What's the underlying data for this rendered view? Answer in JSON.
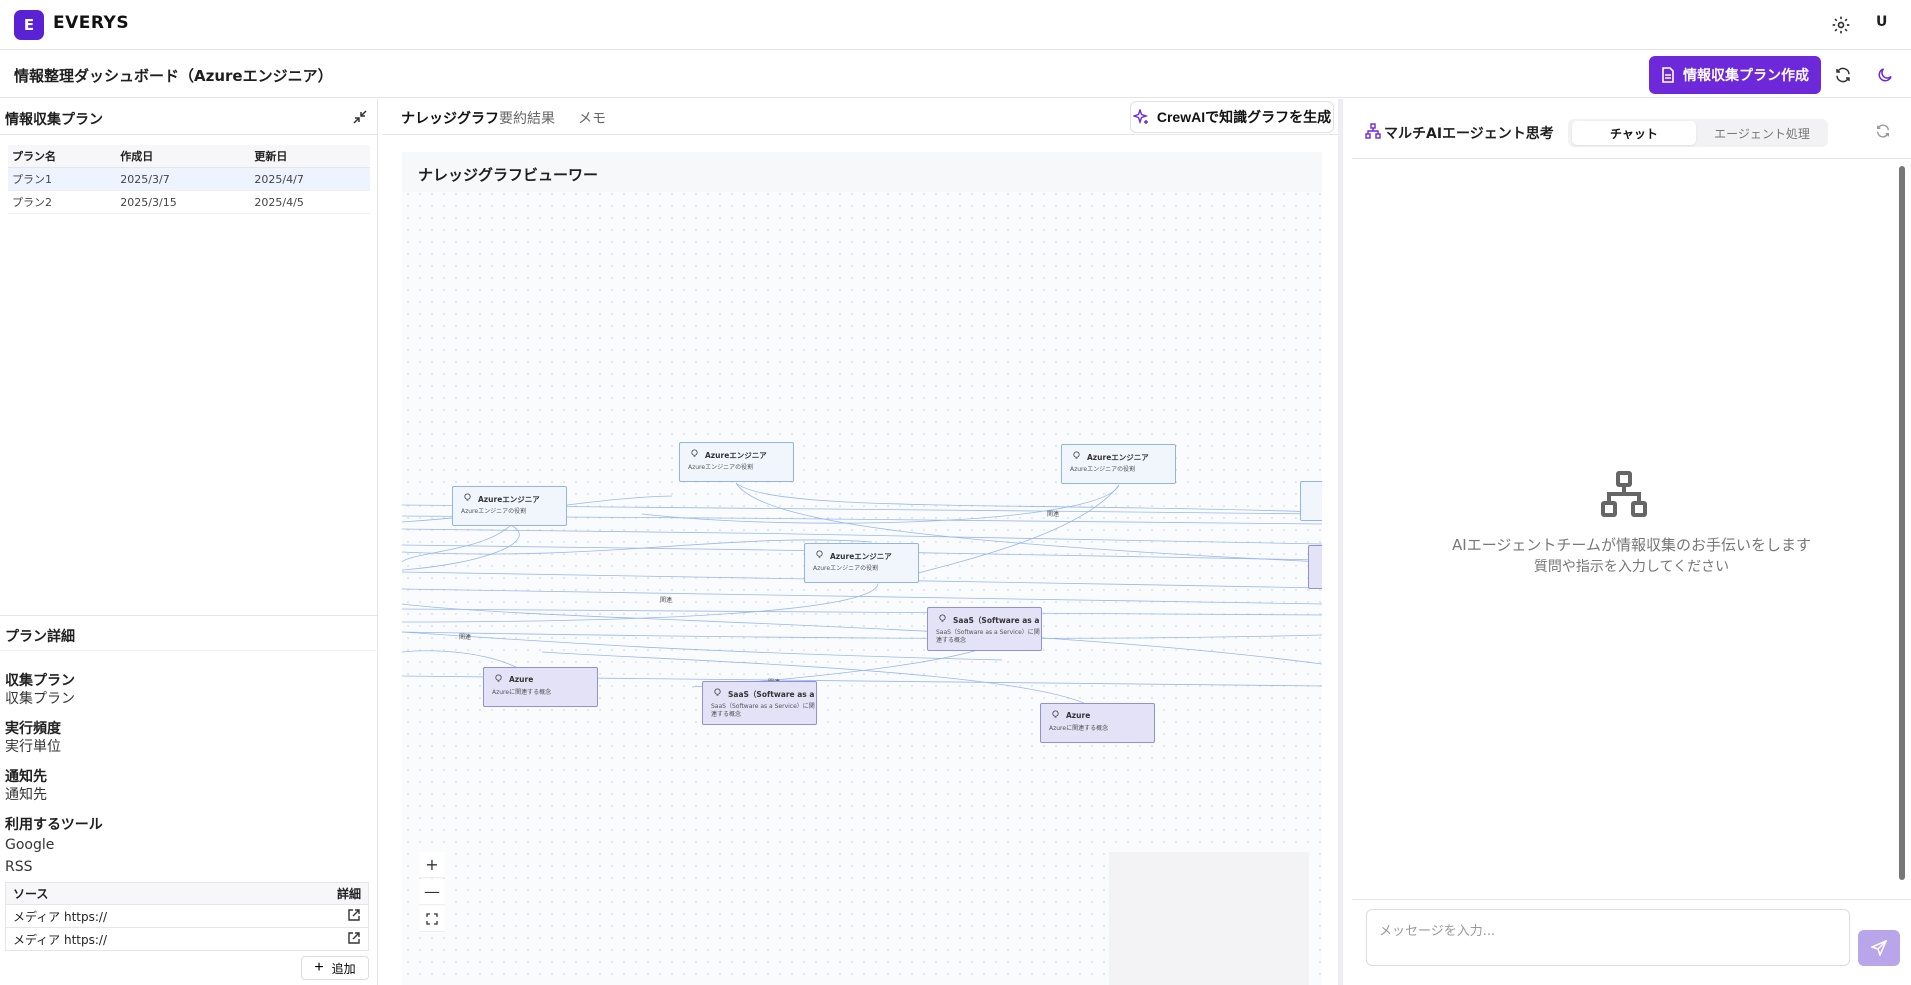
{
  "app": {
    "logo_letter": "E",
    "brand": "EVERYS",
    "user_initial": "U"
  },
  "header": {
    "title": "情報整理ダッシュボード（Azureエンジニア）",
    "create_plan_label": "情報収集プラン作成"
  },
  "left": {
    "title": "情報収集プラン",
    "columns": [
      "プラン名",
      "作成日",
      "更新日"
    ],
    "plans": [
      {
        "name": "プラン1",
        "created": "2025/3/7",
        "updated": "2025/4/7"
      },
      {
        "name": "プラン2",
        "created": "2025/3/15",
        "updated": "2025/4/5"
      }
    ],
    "detail_title": "プラン詳細",
    "details": [
      {
        "label": "収集プラン",
        "value": "収集プラン"
      },
      {
        "label": "実行頻度",
        "value": "実行単位"
      },
      {
        "label": "通知先",
        "value": "通知先"
      }
    ],
    "tools_label": "利用するツール",
    "tools": [
      "Google",
      "RSS"
    ],
    "sources_columns": [
      "ソース",
      "詳細"
    ],
    "sources": [
      "メディア https://",
      "メディア https://"
    ],
    "add_label": "追加"
  },
  "middle": {
    "tabs": [
      "ナレッジグラフ",
      "要約結果",
      "メモ"
    ],
    "crew_button": "CrewAIで知識グラフを生成",
    "graph_title": "ナレッジグラフビューワー",
    "nodes": [
      {
        "title": "Azureエンジニア",
        "desc": "Azureエンジニアの役割"
      },
      {
        "title": "Azureエンジニア",
        "desc": "Azureエンジニアの役割"
      },
      {
        "title": "Azureエンジニア",
        "desc": "Azureエンジニアの役割"
      },
      {
        "title": "Azureエンジニア",
        "desc": "Azureエンジニアの役割"
      },
      {
        "title": "SaaS（Software as a Se...",
        "desc": "SaaS（Software as a Service）に関連する概念"
      },
      {
        "title": "Azure",
        "desc": "Azureに関連する概念"
      },
      {
        "title": "SaaS（Software as a Se...",
        "desc": "SaaS（Software as a Service）に関連する概念"
      },
      {
        "title": "Azure",
        "desc": "Azureに関連する概念"
      }
    ],
    "edge_labels": [
      "関連",
      "関連",
      "関連",
      "関連"
    ],
    "zoom_in": "+",
    "zoom_out": "—"
  },
  "right": {
    "title": "マルチAIエージェント思考",
    "tabs": [
      "チャット",
      "エージェント処理"
    ],
    "empty_line1": "AIエージェントチームが情報収集のお手伝いをします",
    "empty_line2": "質問や指示を入力してください",
    "input_placeholder": "メッセージを入力..."
  },
  "colors": {
    "accent": "#6d28d9",
    "node_blue": "#f1f6fd",
    "node_purple": "#e3e2f6",
    "edge": "#8fb1e8"
  }
}
